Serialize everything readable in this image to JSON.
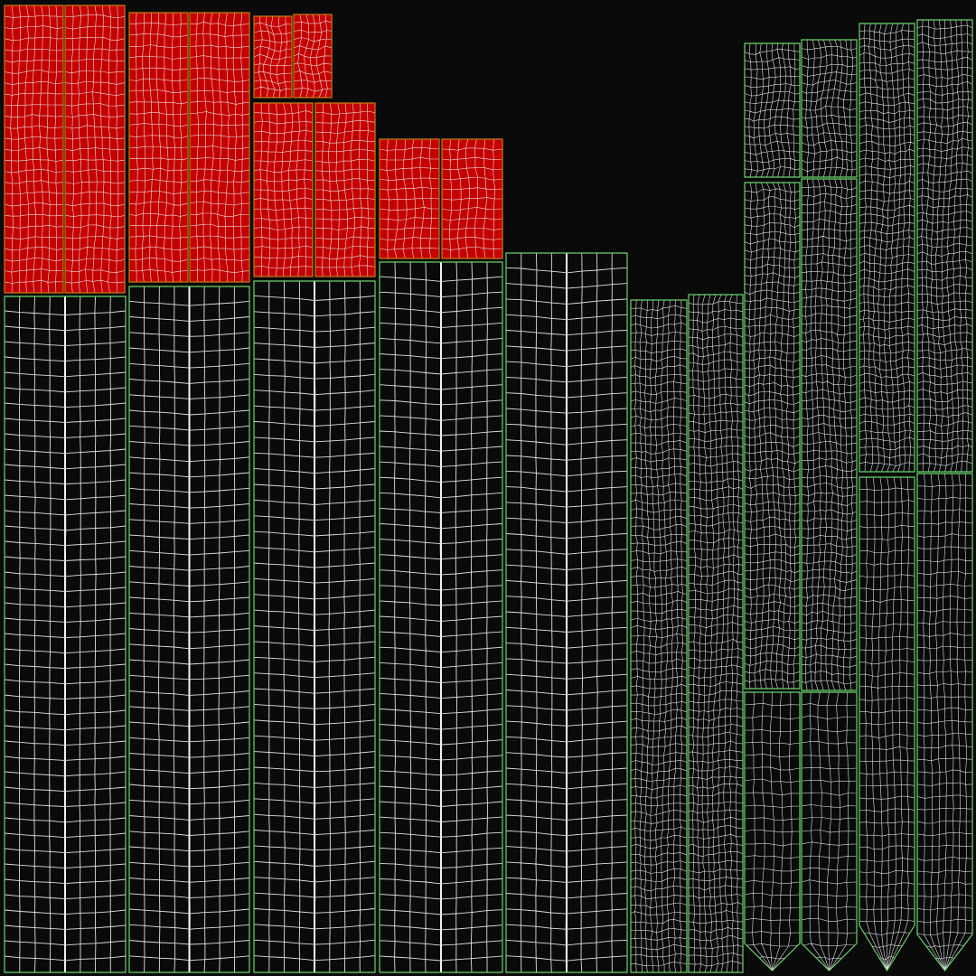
{
  "colors": {
    "background": "#0a0a0a",
    "selected_fill": "#c40000",
    "selected_border": "#c77a10",
    "wire": "#f2f2f2",
    "shell_border": "#69d36b"
  }
}
